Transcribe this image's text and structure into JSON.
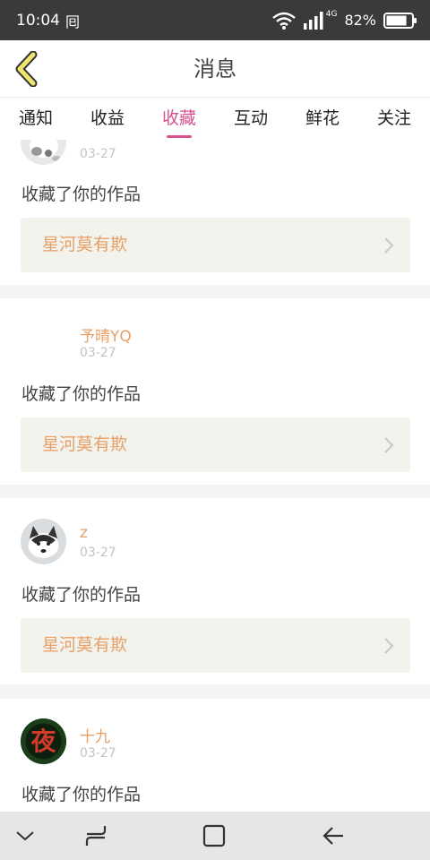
{
  "status_bar": {
    "time": "10:04",
    "notification_icon": "alipay-icon",
    "network": "4G",
    "battery_percent": "82%",
    "battery_level": 0.82
  },
  "header": {
    "title": "消息",
    "back_icon": "chevron-left-icon",
    "back_icon_color": "#f0e470"
  },
  "tabs": [
    {
      "label": "通知",
      "active": false
    },
    {
      "label": "收益",
      "active": false
    },
    {
      "label": "收藏",
      "active": true
    },
    {
      "label": "互动",
      "active": false
    },
    {
      "label": "鲜花",
      "active": false
    },
    {
      "label": "关注",
      "active": false
    }
  ],
  "colors": {
    "accent": "#d5528e",
    "username": "#e8a066",
    "work_title": "#e8a066",
    "work_box_bg": "#f3f3ed"
  },
  "notifications": [
    {
      "user": "",
      "date": "03-27",
      "action": "收藏了你的作品",
      "work": "星河莫有欺",
      "avatar": "dog-photo"
    },
    {
      "user": "予晴YQ",
      "date": "03-27",
      "action": "收藏了你的作品",
      "work": "星河莫有欺",
      "avatar": "none"
    },
    {
      "user": "z",
      "date": "03-27",
      "action": "收藏了你的作品",
      "work": "星河莫有欺",
      "avatar": "husky-photo"
    },
    {
      "user": "十九",
      "date": "03-27",
      "action": "收藏了你的作品",
      "work": "",
      "avatar": "calligraphy-ye"
    }
  ],
  "avatar_glyph": "夜",
  "nav_bar": {
    "icons": [
      "chevron-down-icon",
      "recent-apps-icon",
      "home-icon",
      "back-icon"
    ]
  }
}
